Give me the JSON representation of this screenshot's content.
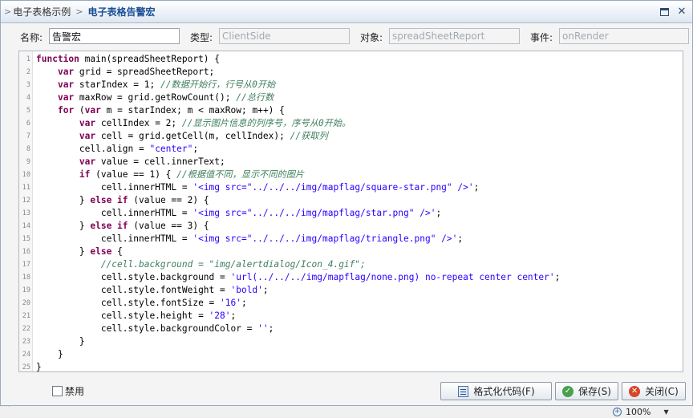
{
  "dialog": {
    "breadcrumb_parent": "电子表格示例",
    "breadcrumb_current": "电子表格告警宏",
    "maximize_glyph": "",
    "close_glyph": "✕"
  },
  "fields": {
    "name_label": "名称:",
    "name_value": "告警宏",
    "type_label": "类型:",
    "type_value": "ClientSide",
    "object_label": "对象:",
    "object_value": "spreadSheetReport",
    "event_label": "事件:",
    "event_value": "onRender"
  },
  "code": {
    "line_numbers": [
      "1",
      "2",
      "3",
      "4",
      "5",
      "6",
      "7",
      "8",
      "9",
      "10",
      "11",
      "12",
      "13",
      "14",
      "15",
      "16",
      "17",
      "18",
      "19",
      "20",
      "21",
      "22",
      "23",
      "24",
      "25"
    ],
    "l1": {
      "kw": "function",
      "t": " main(spreadSheetReport) {"
    },
    "l2": {
      "kw": "var",
      "t": " grid = spreadSheetReport;"
    },
    "l3": {
      "kw": "var",
      "t": " starIndex = 1; ",
      "cm": "//数据开始行，行号从0开始"
    },
    "l4": {
      "kw": "var",
      "t": " maxRow = grid.getRowCount(); ",
      "cm": "//总行数"
    },
    "l5": {
      "kw": "for",
      "t1": " (",
      "kw2": "var",
      "t2": " m = starIndex; m < maxRow; m++) {"
    },
    "l6": {
      "kw": "var",
      "t": " cellIndex = 2; ",
      "cm": "//显示图片信息的列序号，序号从0开始。"
    },
    "l7": {
      "kw": "var",
      "t": " cell = grid.getCell(m, cellIndex); ",
      "cm": "//获取列"
    },
    "l8": {
      "t": "cell.align = ",
      "str": "\"center\"",
      "t2": ";"
    },
    "l9": {
      "kw": "var",
      "t": " value = cell.innerText;"
    },
    "l10": {
      "kw": "if",
      "t": " (value == 1) { ",
      "cm": "//根据值不同，显示不同的图片"
    },
    "l11": {
      "t": "cell.innerHTML = ",
      "str": "'<img src=\"../../../img/mapflag/square-star.png\" />'",
      "t2": ";"
    },
    "l12": {
      "t": "} ",
      "kw": "else if",
      "t2": " (value == 2) {"
    },
    "l13": {
      "t": "cell.innerHTML = ",
      "str": "'<img src=\"../../../img/mapflag/star.png\" />'",
      "t2": ";"
    },
    "l14": {
      "t": "} ",
      "kw": "else if",
      "t2": " (value == 3) {"
    },
    "l15": {
      "t": "cell.innerHTML = ",
      "str": "'<img src=\"../../../img/mapflag/triangle.png\" />'",
      "t2": ";"
    },
    "l16": {
      "t": "} ",
      "kw": "else",
      "t2": " {"
    },
    "l17": {
      "cm": "//cell.background = \"img/alertdialog/Icon_4.gif\";"
    },
    "l18": {
      "t": "cell.style.background = ",
      "str": "'url(../../../img/mapflag/none.png) no-repeat center center'",
      "t2": ";"
    },
    "l19": {
      "t": "cell.style.fontWeight = ",
      "str": "'bold'",
      "t2": ";"
    },
    "l20": {
      "t": "cell.style.fontSize = ",
      "str": "'16'",
      "t2": ";"
    },
    "l21": {
      "t": "cell.style.height = ",
      "str": "'28'",
      "t2": ";"
    },
    "l22": {
      "t": "cell.style.backgroundColor = ",
      "str": "''",
      "t2": ";"
    },
    "l23": {
      "t": "}"
    },
    "l24": {
      "t": "}"
    },
    "l25": {
      "t": "}"
    }
  },
  "footer": {
    "disable_label": "禁用",
    "format_button": "格式化代码(F)",
    "save_button": "保存(S)",
    "close_button": "关闭(C)"
  },
  "statusbar": {
    "zoom_icon_glyph": "+",
    "zoom": "100%",
    "zoom_dropdown_glyph": "▼"
  },
  "colors": {
    "keyword": "#7f0055",
    "string": "#2a00ff",
    "comment": "#3f7f5f",
    "title": "#1a4f95"
  }
}
